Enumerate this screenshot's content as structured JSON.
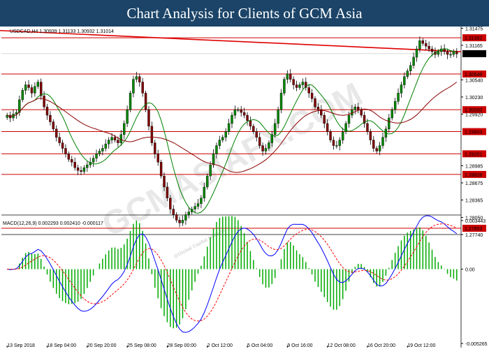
{
  "banner": {
    "title": "Chart Analysis for Clients of GCM Asia"
  },
  "watermark": {
    "text": "GCMASIAFX.COM",
    "small_text": "@Global Capital Markets"
  },
  "chart_data": {
    "type": "candlestick",
    "symbol_header": "USDCAD,H4  1.30939 1.31133 1.30932 1.31014",
    "colors": {
      "bull": "#008800",
      "bear": "#800000",
      "ma_fast": "#008000",
      "ma_slow": "#8b0000",
      "level": "#cc0000",
      "trendline": "#e00000",
      "macd_line": "#0000ff",
      "signal_line": "#ff0000",
      "histogram": "#00aa00"
    },
    "price_ylim": [
      1.2774,
      1.3148
    ],
    "price_ticks": [
      1.31475,
      1.31165,
      1.3054,
      1.3023,
      1.2992,
      1.28985,
      1.28675,
      1.28365,
      1.2805,
      1.2774
    ],
    "last_price": 1.31014,
    "horizontal_levels": [
      1.31302,
      1.30646,
      1.3,
      1.29603,
      1.29201,
      1.28828,
      1.27853
    ],
    "level_labels": [
      "1.31302",
      "1.30646",
      "1.30000",
      "1.29603",
      "1.29201",
      "1.28828",
      "1.27853"
    ],
    "last_price_label": "1.31014",
    "trendline": {
      "start": [
        0,
        1.3145
      ],
      "end": [
        148,
        1.3105
      ]
    },
    "close_series": [
      1.299,
      1.2985,
      1.2992,
      1.2995,
      1.3018,
      1.3035,
      1.3045,
      1.304,
      1.303,
      1.3042,
      1.305,
      1.3025,
      1.3005,
      1.299,
      1.2978,
      1.2965,
      1.295,
      1.294,
      1.293,
      1.292,
      1.291,
      1.2905,
      1.2895,
      1.289,
      1.2888,
      1.2895,
      1.29,
      1.2905,
      1.2912,
      1.292,
      1.2925,
      1.293,
      1.2938,
      1.2945,
      1.295,
      1.2945,
      1.294,
      1.2955,
      1.2975,
      1.3,
      1.303,
      1.3055,
      1.306,
      1.305,
      1.303,
      1.3,
      1.297,
      1.294,
      1.292,
      1.2905,
      1.288,
      1.286,
      1.284,
      1.282,
      1.281,
      1.28,
      1.2795,
      1.28,
      1.281,
      1.2815,
      1.282,
      1.2825,
      1.283,
      1.284,
      1.286,
      1.288,
      1.29,
      1.292,
      1.2935,
      1.2945,
      1.295,
      1.296,
      1.2975,
      1.299,
      1.3,
      1.3,
      1.2995,
      1.299,
      1.298,
      1.297,
      1.296,
      1.295,
      1.2935,
      1.2925,
      1.293,
      1.294,
      1.2955,
      1.2975,
      1.3,
      1.303,
      1.3055,
      1.3065,
      1.3055,
      1.3045,
      1.304,
      1.3045,
      1.305,
      1.304,
      1.303,
      1.302,
      1.3005,
      1.3,
      1.299,
      1.2975,
      1.296,
      1.2945,
      1.2935,
      1.2935,
      1.2945,
      1.296,
      1.2975,
      1.299,
      1.3,
      1.3005,
      1.3,
      1.299,
      1.2975,
      1.296,
      1.2945,
      1.293,
      1.2925,
      1.2935,
      1.295,
      1.2965,
      1.2985,
      1.3,
      1.3015,
      1.303,
      1.3045,
      1.306,
      1.307,
      1.308,
      1.3095,
      1.311,
      1.3125,
      1.312,
      1.3115,
      1.311,
      1.3105,
      1.31,
      1.3105,
      1.311,
      1.3105,
      1.31,
      1.31,
      1.3105,
      1.3101
    ],
    "x_tick_labels": [
      "13 Sep 2018",
      "18 Sep 04:00",
      "20 Sep 20:00",
      "25 Sep 08:00",
      "28 Sep 00:00",
      "2 Oct 12:00",
      "5 Oct 04:00",
      "9 Oct 16:00",
      "12 Oct 08:00",
      "16 Oct 20:00",
      "19 Oct 12:00"
    ],
    "x_tick_indices": [
      0,
      13,
      26,
      39,
      52,
      65,
      78,
      91,
      104,
      117,
      130
    ],
    "macd": {
      "header": "MACD(12,26,9) 0.002293 0.002410 -0.000117",
      "ylim": [
        -0.00526,
        0.00344
      ],
      "ticks": [
        0.003443,
        0.0,
        -0.005265
      ],
      "tick_labels": [
        "0.003443",
        "0.00",
        "-0.005265"
      ]
    }
  }
}
